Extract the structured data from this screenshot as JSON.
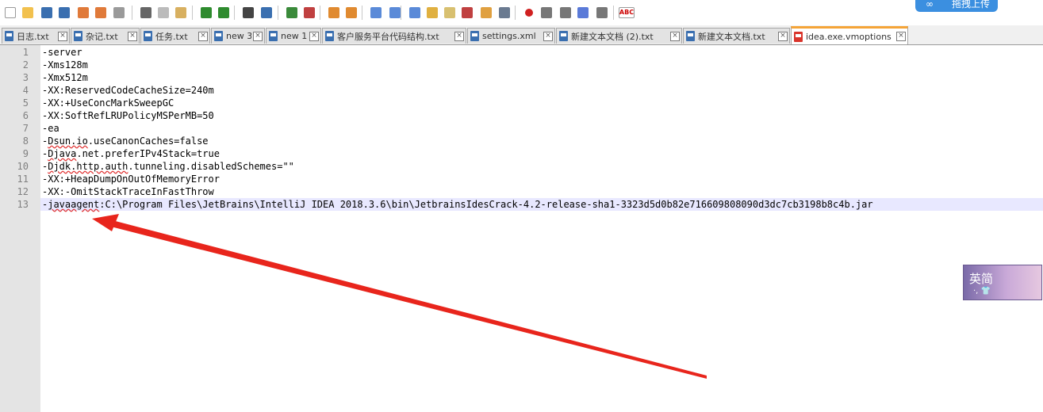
{
  "toolbar": {
    "icons": [
      "new-file-icon",
      "open-file-icon",
      "save-icon",
      "save-all-icon",
      "close-icon",
      "close-all-icon",
      "print-icon",
      "cut-icon",
      "copy-icon",
      "paste-icon",
      "undo-icon",
      "redo-icon",
      "find-icon",
      "replace-icon",
      "zoom-in-icon",
      "zoom-out-icon",
      "sync-vertical-icon",
      "sync-horizontal-icon",
      "word-wrap-icon",
      "show-all-chars-icon",
      "indent-guide-icon",
      "user-language-icon",
      "document-map-icon",
      "function-list-icon",
      "folder-workspace-icon",
      "monitoring-icon",
      "record-macro-icon",
      "stop-recording-icon",
      "play-macro-icon",
      "run-macro-multiple-icon",
      "save-macro-icon",
      "spell-check-icon"
    ],
    "spellcheck_label": "ABC",
    "cloud_upload_label": "拖拽上传"
  },
  "tabs": [
    {
      "label": "日志.txt",
      "active": false
    },
    {
      "label": "杂记.txt",
      "active": false
    },
    {
      "label": "任务.txt",
      "active": false
    },
    {
      "label": "new 3",
      "active": false
    },
    {
      "label": "new 1",
      "active": false
    },
    {
      "label": "客户服务平台代码结构.txt",
      "active": false
    },
    {
      "label": "settings.xml",
      "active": false
    },
    {
      "label": "新建文本文档 (2).txt",
      "active": false
    },
    {
      "label": "新建文本文档.txt",
      "active": false
    },
    {
      "label": "idea.exe.vmoptions",
      "active": true
    }
  ],
  "editor": {
    "current_line": 13,
    "lines": [
      "-server",
      "-Xms128m",
      "-Xmx512m",
      "-XX:ReservedCodeCacheSize=240m",
      "-XX:+UseConcMarkSweepGC",
      "-XX:SoftRefLRUPolicyMSPerMB=50",
      "-ea",
      "-Dsun.io.useCanonCaches=false",
      "-Djava.net.preferIPv4Stack=true",
      "-Djdk.http.auth.tunneling.disabledSchemes=\"\"",
      "-XX:+HeapDumpOnOutOfMemoryError",
      "-XX:-OmitStackTraceInFastThrow",
      "-javaagent:C:\\Program Files\\JetBrains\\IntelliJ IDEA 2018.3.6\\bin\\JetbrainsIdesCrack-4.2-release-sha1-3323d5d0b82e716609808090d3dc7cb3198b8c4b.jar"
    ]
  },
  "ime": {
    "label": "英简",
    "detail": "·, 👕"
  },
  "colors": {
    "accent_tab": "#f5a437",
    "arrow": "#e8251c",
    "current_line": "#e8e8ff"
  }
}
